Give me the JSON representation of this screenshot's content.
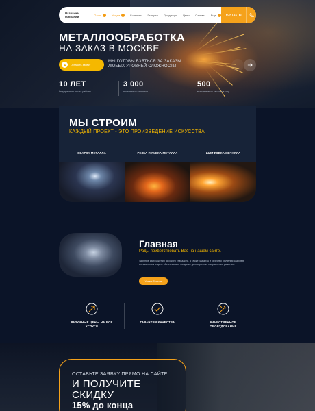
{
  "nav": {
    "logo": "Название компании",
    "items": [
      {
        "label": "О нас",
        "badge": true,
        "active": true
      },
      {
        "label": "Услуги",
        "badge": true,
        "active": true
      },
      {
        "label": "Контакты",
        "badge": false,
        "active": false
      },
      {
        "label": "Галерея",
        "badge": false,
        "active": false
      },
      {
        "label": "Продукция",
        "badge": false,
        "active": false
      },
      {
        "label": "Цены",
        "badge": false,
        "active": false
      },
      {
        "label": "Отзывы",
        "badge": false,
        "active": false
      },
      {
        "label": "Еще",
        "badge": true,
        "active": false
      }
    ],
    "cta": "КОНТАКТЫ"
  },
  "hero": {
    "title": "МЕТАЛЛООБРАБОТКА",
    "subtitle": "НА ЗАКАЗ В МОСКВЕ",
    "button": "Оставить заявку",
    "desc_line1": "МЫ ГОТОВЫ ВЗЯТЬСЯ ЗА ЗАКАЗЫ",
    "desc_line2": "ЛЮБЫХ УРОВНЕЙ СЛОЖНОСТИ",
    "stats": [
      {
        "num": "10 ЛЕТ",
        "label": "безупречного опыта работы"
      },
      {
        "num": "3 000",
        "label": "постоянных клиентов"
      },
      {
        "num": "500",
        "label": "выполненных заказов в год"
      }
    ]
  },
  "build": {
    "title": "МЫ СТРОИМ",
    "subtitle": "КАЖДЫЙ ПРОЕКТ - ЭТО ПРОИЗВЕДЕНИЕ ИСКУССТВА",
    "categories": [
      "СВАРКА МЕТАЛЛА",
      "РЕЗКА И РУБКА МЕТАЛЛА",
      "ШЛИФОВКА МЕТАЛЛА"
    ]
  },
  "about": {
    "title": "Главная",
    "subtitle": "Рады приветствовать Вас на нашем сайте.",
    "text": "Удобные изображения высокого стандарта, а также размеры и качество обучения кадров в специальном отделе обеспечивают создание долгосрочных направления развития.",
    "button": "Узнать больше"
  },
  "features": [
    {
      "label_line1": "РАЗУМНЫЕ ЦЕНЫ НА ВСЕ",
      "label_line2": "УСЛУГИ",
      "icon": "price-icon"
    },
    {
      "label_line1": "ГАРАНТИЯ КАЧЕСТВА",
      "label_line2": "",
      "icon": "quality-icon"
    },
    {
      "label_line1": "КАЧЕСТВЕННОЕ",
      "label_line2": "ОБОРУДОВАНИЕ",
      "icon": "equipment-icon"
    }
  ],
  "promo": {
    "line1": "ОСТАВЬТЕ ЗАЯВКУ ПРЯМО НА САЙТЕ",
    "line2": "И ПОЛУЧИТЕ",
    "line3": "СКИДКУ",
    "line4": "15% до конца"
  },
  "colors": {
    "accent": "#f5a21b",
    "yellow": "#f5b800",
    "bg": "#0b1428",
    "card": "#172338"
  }
}
